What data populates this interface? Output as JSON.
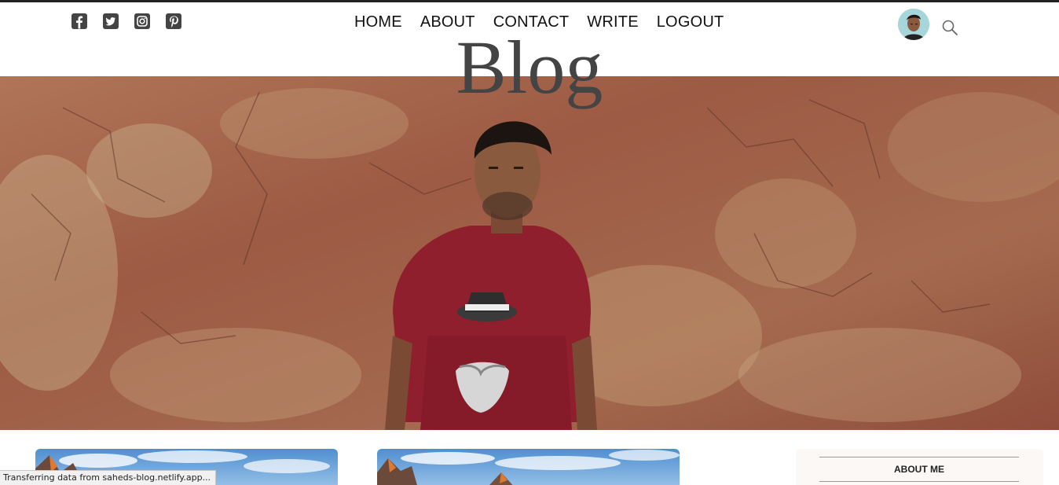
{
  "topbar": {
    "social_icons": [
      "facebook-icon",
      "twitter-icon",
      "instagram-icon",
      "pinterest-icon"
    ],
    "nav": [
      "HOME",
      "ABOUT",
      "CONTACT",
      "WRITE",
      "LOGOUT"
    ],
    "search_icon": "search-icon"
  },
  "header": {
    "brand_title": "Blog"
  },
  "sidebar": {
    "title": "ABOUT ME"
  },
  "status": {
    "text": "Transferring data from saheds-blog.netlify.app..."
  },
  "colors": {
    "brand_text": "#444444",
    "wall": "#9c5a45",
    "shirt": "#8f1f2c"
  }
}
